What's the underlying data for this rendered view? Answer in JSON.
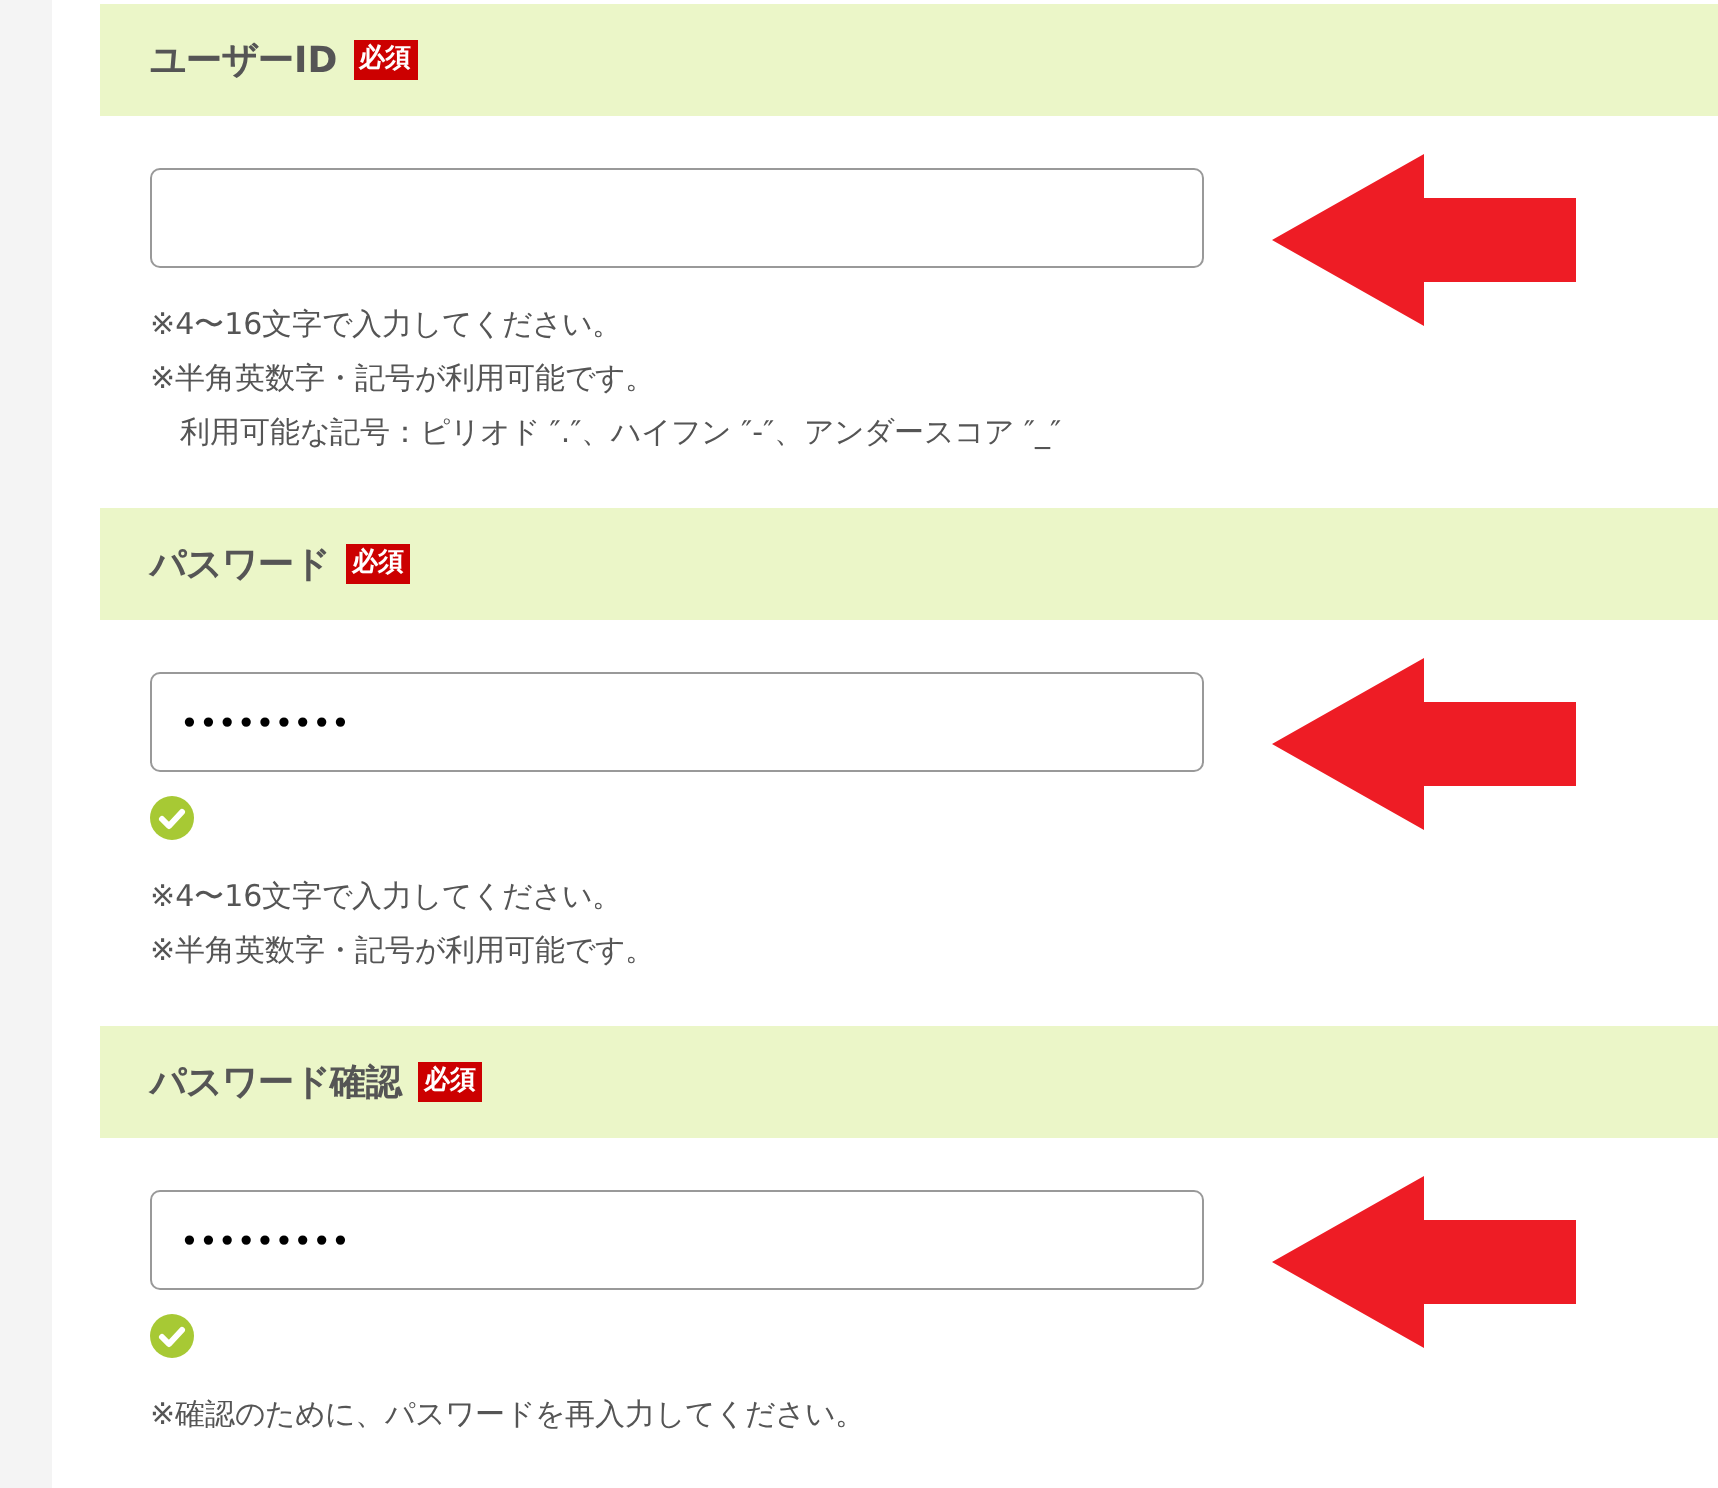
{
  "fields": [
    {
      "label": "ユーザーID",
      "required_badge": "必須",
      "valid": false,
      "arrow": true,
      "notes": [
        "※4〜16文字で入力してください。",
        "※半角英数字・記号が利用可能です。",
        "　利用可能な記号：ピリオド ″.″、ハイフン ″-″、アンダースコア ″_″"
      ]
    },
    {
      "label": "パスワード",
      "required_badge": "必須",
      "value": "•••••••••",
      "valid": true,
      "arrow": true,
      "notes": [
        "※4〜16文字で入力してください。",
        "※半角英数字・記号が利用可能です。"
      ]
    },
    {
      "label": "パスワード確認",
      "required_badge": "必須",
      "value": "•••••••••",
      "valid": true,
      "arrow": true,
      "notes": [
        "※確認のために、パスワードを再入力してください。"
      ]
    }
  ]
}
